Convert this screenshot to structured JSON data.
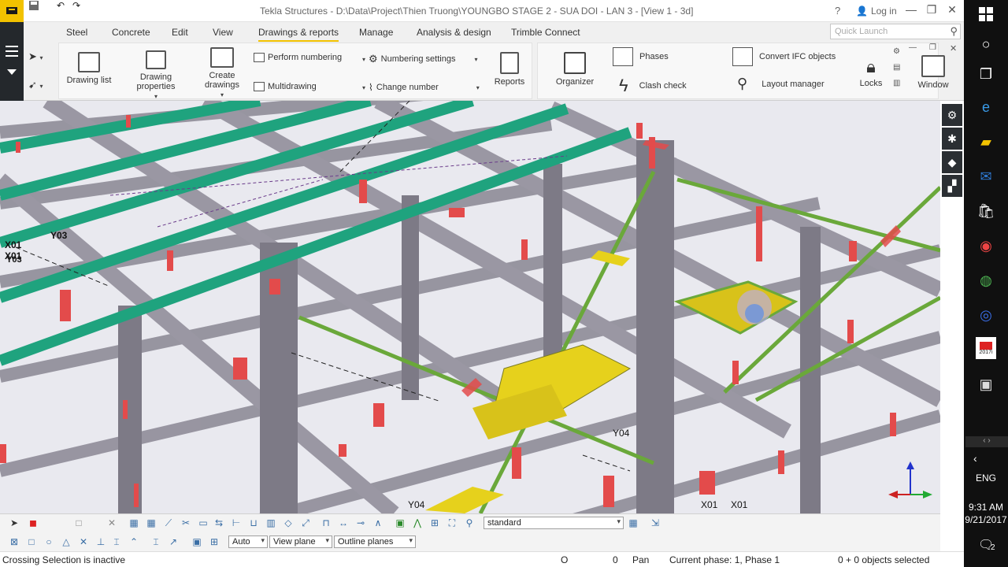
{
  "window": {
    "title": "Tekla Structures - D:\\Data\\Project\\Thien Truong\\YOUNGBO STAGE 2 - SUA DOI - LAN 3  - [View 1 - 3d]",
    "help_label": "?",
    "login_label": "Log in",
    "minimize_label": "—",
    "maximize_label": "❐",
    "close_label": "✕"
  },
  "tabs": [
    {
      "label": "Steel"
    },
    {
      "label": "Concrete"
    },
    {
      "label": "Edit"
    },
    {
      "label": "View"
    },
    {
      "label": "Drawings & reports",
      "active": true
    },
    {
      "label": "Manage"
    },
    {
      "label": "Analysis & design"
    },
    {
      "label": "Trimble Connect"
    }
  ],
  "quick_launch": {
    "placeholder": "Quick Launch"
  },
  "ribbon": {
    "drawing_list": "Drawing list",
    "drawing_properties": "Drawing properties",
    "create_drawings": "Create drawings",
    "perform_numbering": "Perform numbering",
    "multidrawing": "Multidrawing",
    "numbering_settings": "Numbering settings",
    "change_number": "Change number",
    "reports": "Reports",
    "organizer": "Organizer",
    "phases": "Phases",
    "clash_check": "Clash check",
    "convert_ifc": "Convert IFC objects",
    "layout_manager": "Layout manager",
    "locks": "Locks",
    "window": "Window"
  },
  "viewport": {
    "grid_labels": [
      "X01",
      "Y03",
      "X01",
      "Y03",
      "Y04",
      "Y04",
      "X01",
      "X01"
    ]
  },
  "bottom": {
    "view_filter_value": "standard",
    "snap_depth_value": "Auto",
    "plane_value": "View plane",
    "outline_value": "Outline planes"
  },
  "status": {
    "message": "Crossing Selection is inactive",
    "o_label": "O",
    "zero": "0",
    "mode": "Pan",
    "phase": "Current phase: 1, Phase 1",
    "selected": "0 + 0 objects selected"
  },
  "taskbar": {
    "lang": "ENG",
    "time": "9:31 AM",
    "date": "9/21/2017",
    "notif_count": "2",
    "tekla_year": "2017i"
  },
  "colors": {
    "accent": "#f2c200",
    "steel": "#8f8c98",
    "teal": "#1fa37e",
    "brace": "#6aa83a",
    "red_plate": "#e34b4b",
    "yellow_stair": "#e6d11c"
  }
}
